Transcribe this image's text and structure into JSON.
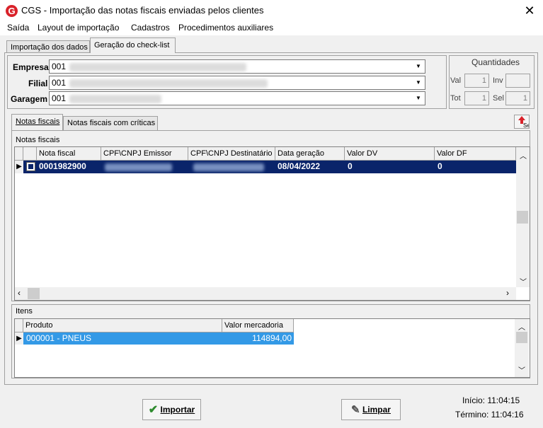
{
  "window": {
    "title": "CGS - Importação das notas fiscais enviadas pelos clientes",
    "app_icon": "G"
  },
  "menu": [
    "Saída",
    "Layout de importação",
    "Cadastros",
    "Procedimentos auxiliares"
  ],
  "main_tabs": [
    "Importação dos dados",
    "Geração do check-list"
  ],
  "fields": {
    "empresa": {
      "label": "Empresa",
      "code": "001"
    },
    "filial": {
      "label": "Filial",
      "code": "001"
    },
    "garagem": {
      "label": "Garagem",
      "code": "001"
    }
  },
  "quantidades": {
    "title": "Quantidades",
    "val_label": "Val",
    "val": "1",
    "inv_label": "Inv",
    "inv": "",
    "tot_label": "Tot",
    "tot": "1",
    "sel_label": "Sel",
    "sel": "1"
  },
  "sub_tabs": [
    "Notas fiscais",
    "Notas fiscais com críticas"
  ],
  "sel_button": "Sel",
  "notas": {
    "title": "Notas fiscais",
    "columns": [
      "Nota fiscal",
      "CPF\\CNPJ Emissor",
      "CPF\\CNPJ Destinatário",
      "Data geração",
      "Valor DV",
      "Valor DF"
    ],
    "row": {
      "nota": "0001982900",
      "data": "08/04/2022",
      "valor_dv": "0",
      "valor_df": "0"
    }
  },
  "itens": {
    "title": "Itens",
    "columns": [
      "Produto",
      "Valor mercadoria"
    ],
    "row": {
      "produto": "000001 - PNEUS",
      "valor": "114894,00"
    }
  },
  "buttons": {
    "importar": "Importar",
    "limpar": "Limpar"
  },
  "status": {
    "inicio": "Início: 11:04:15",
    "termino": "Término: 11:04:16"
  },
  "colors": {
    "selection_dark": "#0a246a",
    "selection_light": "#3399e6",
    "icon_red": "#d9222a",
    "ok_green": "#2e8b2e"
  }
}
